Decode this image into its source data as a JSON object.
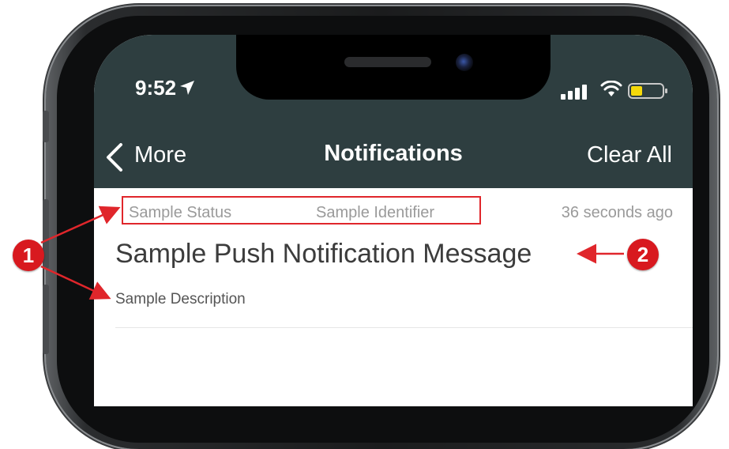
{
  "status_bar": {
    "time": "9:52"
  },
  "nav": {
    "back_label": "More",
    "title": "Notifications",
    "clear_label": "Clear All"
  },
  "notification": {
    "status": "Sample Status",
    "identifier": "Sample Identifier",
    "age": "36 seconds ago",
    "message": "Sample Push Notification Message",
    "description": "Sample Description"
  },
  "annotations": {
    "badge_1": "1",
    "badge_2": "2"
  },
  "icons": [
    "location-arrow-icon",
    "signal-icon",
    "wifi-icon",
    "battery-icon",
    "chevron-left-icon"
  ],
  "colors": {
    "header": "#2e3e40",
    "annotation_red": "#e0262b",
    "battery_fill": "#f5d90a"
  }
}
